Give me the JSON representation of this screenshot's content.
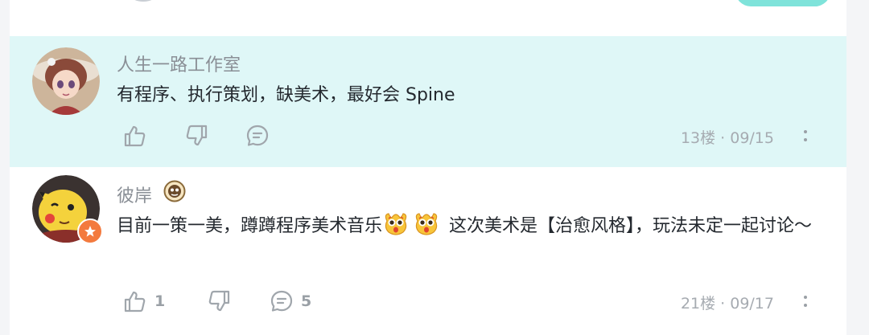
{
  "comments": [
    {
      "username": "人生一路工作室",
      "text": "有程序、执行策划，缺美术，最好会 Spine",
      "likes": "",
      "replies": "",
      "floor": "13楼 · 09/15"
    },
    {
      "username": "彼岸",
      "text_before_emoji": "目前一策一美，蹲蹲程序美术音乐",
      "text_after_emoji": " 这次美术是【治愈风格】，玩法未定一起讨论～",
      "likes": "1",
      "replies": "5",
      "floor": "21楼 · 09/17"
    }
  ],
  "colors": {
    "highlight_bg": "#dff7f7",
    "accent": "#7fe3da",
    "badge_orange": "#f37a3e"
  }
}
